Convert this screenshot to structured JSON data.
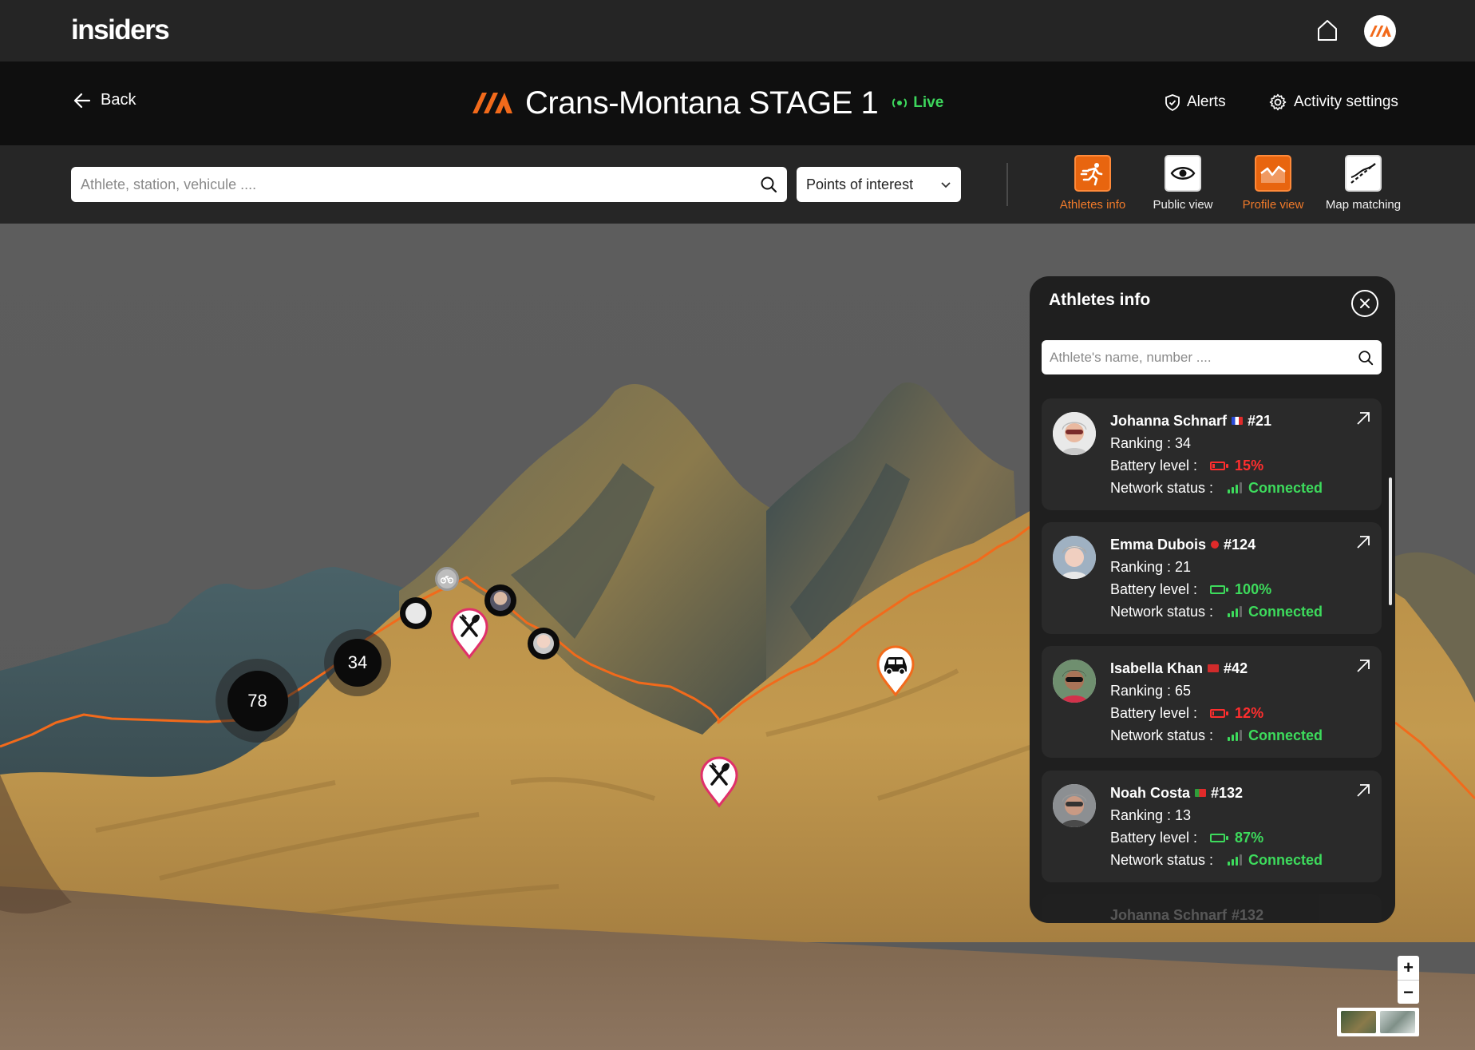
{
  "app": {
    "logo_text": "insiders"
  },
  "header": {
    "back_label": "Back",
    "title": "Crans-Montana STAGE 1",
    "live_label": "Live",
    "alerts_label": "Alerts",
    "settings_label": "Activity settings"
  },
  "toolbar": {
    "search_placeholder": "Athlete, station, vehicule ....",
    "poi_label": "Points of interest",
    "tools": [
      {
        "label": "Athletes info",
        "icon": "runner-icon",
        "active": true
      },
      {
        "label": "Public view",
        "icon": "eye-icon",
        "active": false
      },
      {
        "label": "Profile view",
        "icon": "profile-chart-icon",
        "active": true
      },
      {
        "label": "Map matching",
        "icon": "route-matching-icon",
        "active": false
      }
    ]
  },
  "map": {
    "clusters": [
      {
        "label": "78"
      },
      {
        "label": "34"
      }
    ],
    "poi_markers": [
      "food-icon",
      "food-icon",
      "car-icon",
      "bike-icon"
    ],
    "accent_color": "#f26a1b"
  },
  "panel": {
    "title": "Athletes info",
    "search_placeholder": "Athlete's name, number ....",
    "athletes": [
      {
        "name": "Johanna Schnarf",
        "number": "#21",
        "ranking_label": "Ranking : 34",
        "battery_label": "Battery level :",
        "battery": "15%",
        "battery_state": "low",
        "network_label": "Network status :",
        "network": "Connected",
        "flag": "france"
      },
      {
        "name": "Emma Dubois",
        "number": "#124",
        "ranking_label": "Ranking : 21",
        "battery_label": "Battery level :",
        "battery": "100%",
        "battery_state": "ok",
        "network_label": "Network status :",
        "network": "Connected",
        "flag": "switzerland"
      },
      {
        "name": "Isabella Khan",
        "number": "#42",
        "ranking_label": "Ranking : 65",
        "battery_label": "Battery level :",
        "battery": "12%",
        "battery_state": "low",
        "network_label": "Network status :",
        "network": "Connected",
        "flag": "morocco"
      },
      {
        "name": "Noah Costa",
        "number": "#132",
        "ranking_label": "Ranking : 13",
        "battery_label": "Battery level :",
        "battery": "87%",
        "battery_state": "ok",
        "network_label": "Network status :",
        "network": "Connected",
        "flag": "portugal"
      }
    ],
    "ghost_name": "Johanna Schnarf",
    "ghost_number": "#132"
  },
  "controls": {
    "zoom_in": "+",
    "zoom_out": "−"
  },
  "colors": {
    "accent": "#e8650f",
    "live": "#3dd65c",
    "battery_low": "#ff2e2e",
    "battery_ok": "#3ddb5c"
  }
}
